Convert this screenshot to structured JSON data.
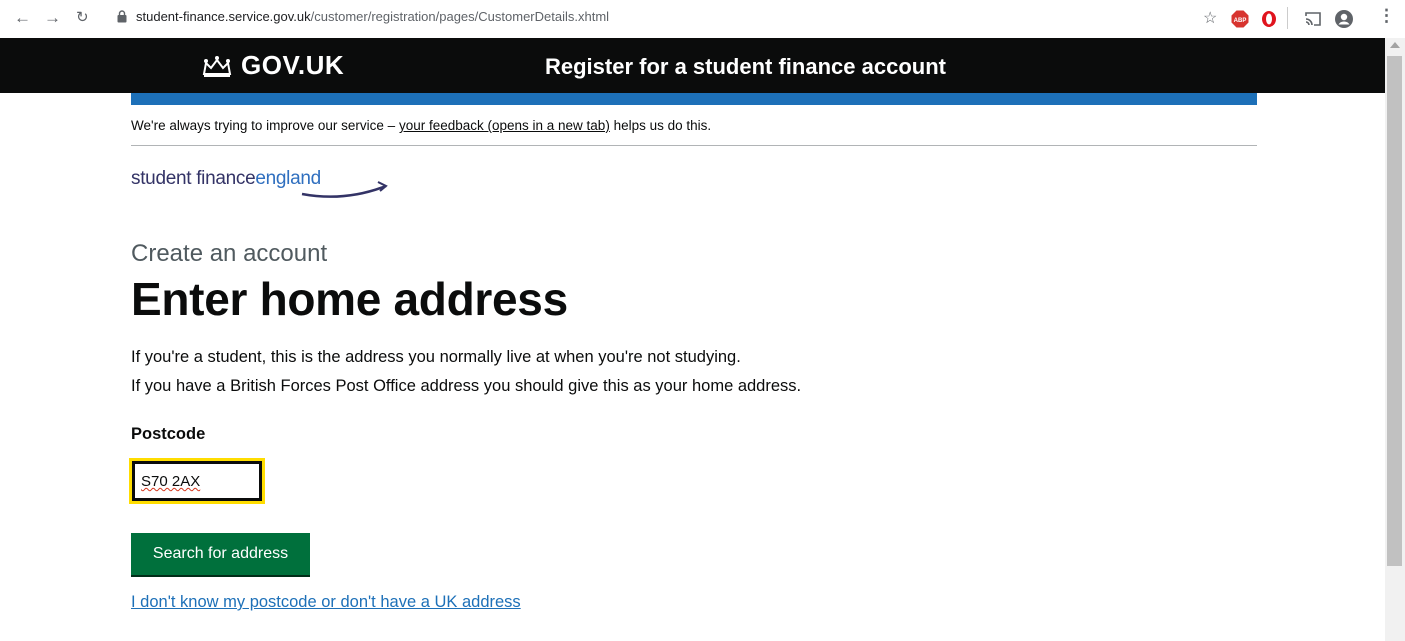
{
  "browser": {
    "url_domain": "student-finance.service.gov.uk",
    "url_path": "/customer/registration/pages/CustomerDetails.xhtml",
    "icons": [
      "back-arrow-icon",
      "forward-arrow-icon",
      "reload-icon",
      "lock-icon",
      "star-icon",
      "adblock-icon",
      "opera-icon",
      "cast-icon",
      "account-icon",
      "menu-icon"
    ]
  },
  "header": {
    "logo_text": "GOV.UK",
    "service_name": "Register for a student finance account"
  },
  "feedback": {
    "prefix": "We're always trying to improve our service – ",
    "link": "your feedback (opens in a new tab)",
    "suffix": " helps us do this."
  },
  "brand": {
    "word1": "student finance",
    "word2": "england"
  },
  "page": {
    "caption": "Create an account",
    "title": "Enter home address",
    "intro1": "If you're a student, this is the address you normally live at when you're not studying.",
    "intro2": "If you have a British Forces Post Office address you should give this as your home address."
  },
  "form": {
    "postcode_label": "Postcode",
    "postcode_value": "S70 2AX",
    "search_button": "Search for address",
    "no_postcode_link": "I don't know my postcode or don't have a UK address"
  },
  "colors": {
    "header_bg": "#0b0c0c",
    "accent_blue": "#1d70b8",
    "button_green": "#00703c",
    "focus_yellow": "#ffdd00"
  }
}
